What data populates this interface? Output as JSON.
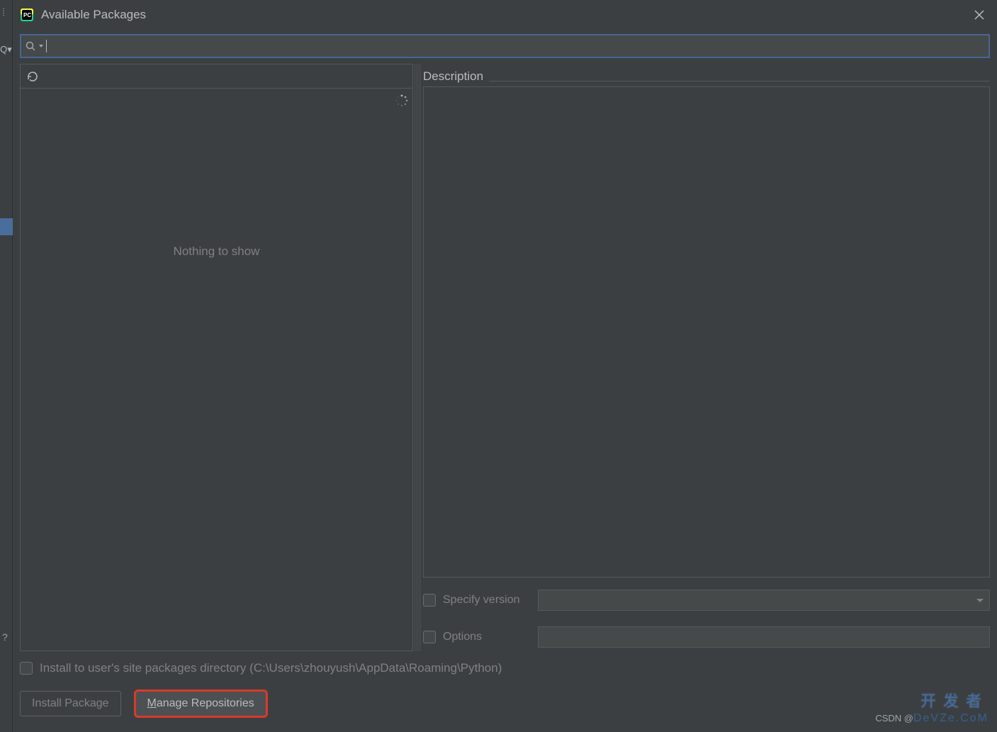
{
  "window": {
    "title": "Available Packages"
  },
  "search": {
    "value": "",
    "placeholder": ""
  },
  "left": {
    "empty_text": "Nothing to show"
  },
  "right": {
    "description_label": "Description",
    "specify_version_label": "Specify version",
    "options_label": "Options",
    "specify_version_value": "",
    "options_value": ""
  },
  "install_sitepkgs": {
    "label": "Install to user's site packages directory (C:\\Users\\zhouyush\\AppData\\Roaming\\Python)",
    "checked": false
  },
  "buttons": {
    "install_label": "Install Package",
    "manage_label_prefix": "M",
    "manage_label_rest": "anage Repositories"
  },
  "watermark": {
    "cn": "开发者",
    "csdn_prefix": "CSDN @",
    "domain": "DeVZe.CoM"
  }
}
